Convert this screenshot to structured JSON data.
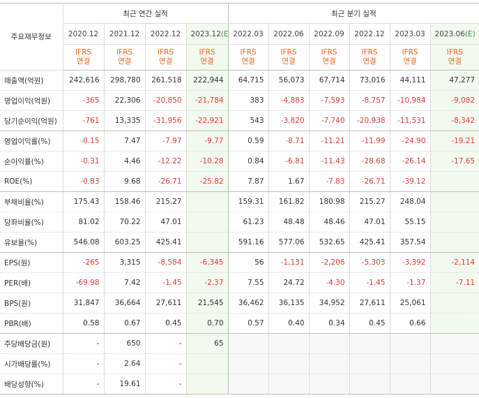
{
  "header": {
    "label_col": "주요재무정보",
    "annual_group": "최근 연간 실적",
    "quarterly_group": "최근 분기 실적",
    "annual_periods": [
      "2020.12",
      "2021.12",
      "2022.12",
      "2023.12"
    ],
    "annual_est_mark": "(E)",
    "quarterly_periods": [
      "2022.03",
      "2022.06",
      "2022.09",
      "2022.12",
      "2023.03",
      "2023.06"
    ],
    "quarterly_est_mark": "(E)",
    "ifrs_top": "IFRS",
    "ifrs_bottom": "연결"
  },
  "rows": [
    {
      "label": "매출액(억원)",
      "values": [
        "242,616",
        "298,780",
        "261,518",
        "222,944",
        "64,715",
        "56,073",
        "67,714",
        "73,016",
        "44,111",
        "47,277"
      ]
    },
    {
      "label": "영업이익(억원)",
      "values": [
        "-365",
        "22,306",
        "-20,850",
        "-21,784",
        "383",
        "-4,883",
        "-7,593",
        "-8,757",
        "-10,984",
        "-9,082"
      ]
    },
    {
      "label": "당기순이익(억원)",
      "values": [
        "-761",
        "13,335",
        "-31,956",
        "-22,921",
        "543",
        "-3,820",
        "-7,740",
        "-20,938",
        "-11,531",
        "-8,342"
      ]
    },
    {
      "label": "영업이익률(%)",
      "values": [
        "-0.15",
        "7.47",
        "-7.97",
        "-9.77",
        "0.59",
        "-8.71",
        "-11.21",
        "-11.99",
        "-24.90",
        "-19.21"
      ]
    },
    {
      "label": "순이익률(%)",
      "values": [
        "-0.31",
        "4.46",
        "-12.22",
        "-10.28",
        "0.84",
        "-6.81",
        "-11.43",
        "-28.68",
        "-26.14",
        "-17.65"
      ]
    },
    {
      "label": "ROE(%)",
      "values": [
        "-0.83",
        "9.68",
        "-26.71",
        "-25.82",
        "7.87",
        "1.67",
        "-7.83",
        "-26.71",
        "-39.12",
        ""
      ]
    },
    {
      "label": "부채비율(%)",
      "values": [
        "175.43",
        "158.46",
        "215.27",
        "",
        "159.31",
        "161.82",
        "180.98",
        "215.27",
        "248.04",
        ""
      ]
    },
    {
      "label": "당좌비율(%)",
      "values": [
        "81.02",
        "70.22",
        "47.01",
        "",
        "61.23",
        "48.48",
        "48.46",
        "47.01",
        "55.15",
        ""
      ]
    },
    {
      "label": "유보율(%)",
      "values": [
        "546.08",
        "603.25",
        "425.41",
        "",
        "591.16",
        "577.06",
        "532.65",
        "425.41",
        "357.54",
        ""
      ]
    },
    {
      "label": "EPS(원)",
      "values": [
        "-265",
        "3,315",
        "-8,584",
        "-6,345",
        "56",
        "-1,131",
        "-2,206",
        "-5,303",
        "-3,392",
        "-2,114"
      ]
    },
    {
      "label": "PER(배)",
      "values": [
        "-69.98",
        "7.42",
        "-1.45",
        "-2.37",
        "7.55",
        "24.72",
        "-4.30",
        "-1.45",
        "-1.37",
        "-7.11"
      ]
    },
    {
      "label": "BPS(원)",
      "values": [
        "31,847",
        "36,664",
        "27,611",
        "21,545",
        "36,462",
        "36,135",
        "34,952",
        "27,611",
        "25,061",
        ""
      ]
    },
    {
      "label": "PBR(배)",
      "values": [
        "0.58",
        "0.67",
        "0.45",
        "0.70",
        "0.57",
        "0.40",
        "0.34",
        "0.45",
        "0.66",
        ""
      ]
    },
    {
      "label": "주당배당금(원)",
      "values": [
        "-",
        "650",
        "-",
        "65",
        "",
        "",
        "",
        "",
        "",
        ""
      ]
    },
    {
      "label": "시가배당률(%)",
      "values": [
        "-",
        "2.64",
        "-",
        "",
        "",
        "",
        "",
        "",
        "",
        ""
      ]
    },
    {
      "label": "배당성향(%)",
      "values": [
        "-",
        "19.61",
        "-",
        "",
        "",
        "",
        "",
        "",
        "",
        ""
      ]
    }
  ],
  "colors": {
    "negative": "#e03a3a",
    "ifrs_label": "#e8641e",
    "estimate_bg": "#f2f9ee",
    "estimate_mark": "#3c9a3c"
  }
}
